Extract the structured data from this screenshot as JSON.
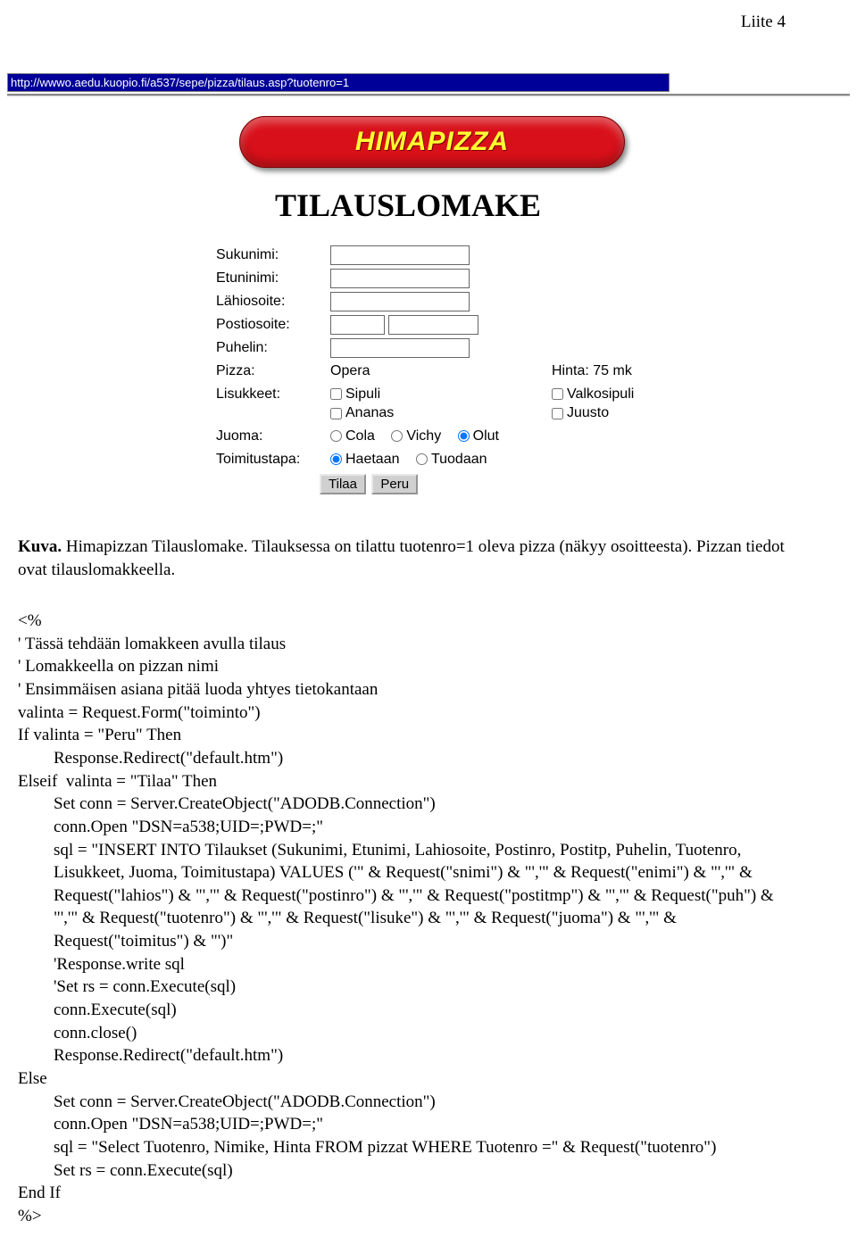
{
  "header": "Liite 4",
  "url": "http://wwwo.aedu.kuopio.fi/a537/sepe/pizza/tilaus.asp?tuotenro=1",
  "brand": "HIMAPIZZA",
  "form": {
    "title": "TILAUSLOMAKE",
    "labels": {
      "sukunimi": "Sukunimi:",
      "etunimi": "Etuninimi:",
      "lahiosoite": "Lähiosoite:",
      "postiosoite": "Postiosoite:",
      "puhelin": "Puhelin:",
      "pizza": "Pizza:",
      "hinta": "Hinta: 75 mk",
      "lisukkeet": "Lisukkeet:",
      "juoma": "Juoma:",
      "toimitustapa": "Toimitustapa:"
    },
    "pizza_value": "Opera",
    "lisukkeet": {
      "sipuli": "Sipuli",
      "ananas": "Ananas",
      "valkosipuli": "Valkosipuli",
      "juusto": "Juusto"
    },
    "juoma": {
      "cola": "Cola",
      "vichy": "Vichy",
      "olut": "Olut"
    },
    "toimitus": {
      "haetaan": "Haetaan",
      "tuodaan": "Tuodaan"
    },
    "buttons": {
      "tilaa": "Tilaa",
      "peru": "Peru"
    }
  },
  "caption": {
    "label": "Kuva.",
    "text": " Himapizzan Tilauslomake. Tilauksessa on tilattu tuotenro=1 oleva pizza (näkyy osoitteesta). Pizzan tiedot ovat tilauslomakkeella."
  },
  "code": {
    "l1": "<%",
    "l2": "' Tässä tehdään lomakkeen avulla tilaus",
    "l3": "' Lomakkeella on pizzan nimi",
    "l4": "' Ensimmäisen asiana pitää luoda yhtyes tietokantaan",
    "l5": "valinta = Request.Form(\"toiminto\")",
    "l6": "If valinta = \"Peru\" Then",
    "l7": "Response.Redirect(\"default.htm\")",
    "l8": "Elseif  valinta = \"Tilaa\" Then",
    "l9": "Set conn = Server.CreateObject(\"ADODB.Connection\")",
    "l10": "conn.Open \"DSN=a538;UID=;PWD=;\"",
    "l11": "sql = \"INSERT INTO Tilaukset (Sukunimi, Etunimi, Lahiosoite, Postinro, Postitp, Puhelin, Tuotenro, Lisukkeet, Juoma, Toimitustapa) VALUES ('\" & Request(\"snimi\") & \"','\" & Request(\"enimi\") & \"','\" & Request(\"lahios\") & \"','\" & Request(\"postinro\") & \"','\" & Request(\"postitmp\") & \"','\" & Request(\"puh\") & \"','\" & Request(\"tuotenro\") & \"','\" & Request(\"lisuke\") & \"','\" & Request(\"juoma\") & \"','\" & Request(\"toimitus\") & \"')\"",
    "l12": "'Response.write sql",
    "l13": "'Set rs = conn.Execute(sql)",
    "l14": "conn.Execute(sql)",
    "l15": "conn.close()",
    "l16": "Response.Redirect(\"default.htm\")",
    "l17": "Else",
    "l18": "Set conn = Server.CreateObject(\"ADODB.Connection\")",
    "l19": "conn.Open \"DSN=a538;UID=;PWD=;\"",
    "l20": "sql = \"Select Tuotenro, Nimike, Hinta FROM pizzat WHERE Tuotenro =\" & Request(\"tuotenro\")",
    "l21": "Set rs = conn.Execute(sql)",
    "l22": "End If",
    "l23": "%>"
  }
}
